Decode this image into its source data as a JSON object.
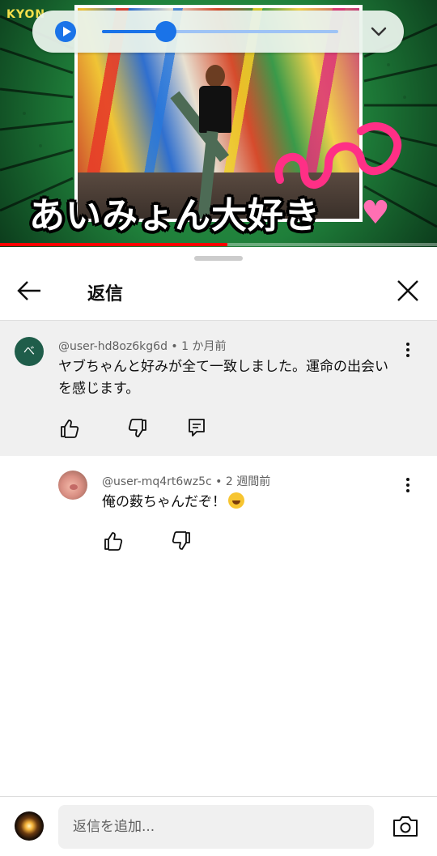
{
  "video": {
    "channel_logo": "KYON",
    "caption": "あいみょん大好き",
    "heart_icon": "pink-heart-icon",
    "progress": 0.52
  },
  "player": {
    "play_icon": "play-icon",
    "seek_position": 0.27,
    "collapse_icon": "chevron-down-icon",
    "accent_color": "#1a73e8"
  },
  "sheet": {
    "title": "返信",
    "back_icon": "arrow-left-icon",
    "close_icon": "close-icon"
  },
  "parent_comment": {
    "avatar_letter": "べ",
    "author": "@user-hd8oz6kg6d",
    "time": "1 か月前",
    "text": "ヤブちゃんと好みが全て一致しました。運命の出会いを感じます。"
  },
  "reply": {
    "author": "@user-mq4rt6wz5c",
    "time": "2 週間前",
    "text": "俺の薮ちゃんだぞ！"
  },
  "composer": {
    "placeholder": "返信を追加..."
  }
}
